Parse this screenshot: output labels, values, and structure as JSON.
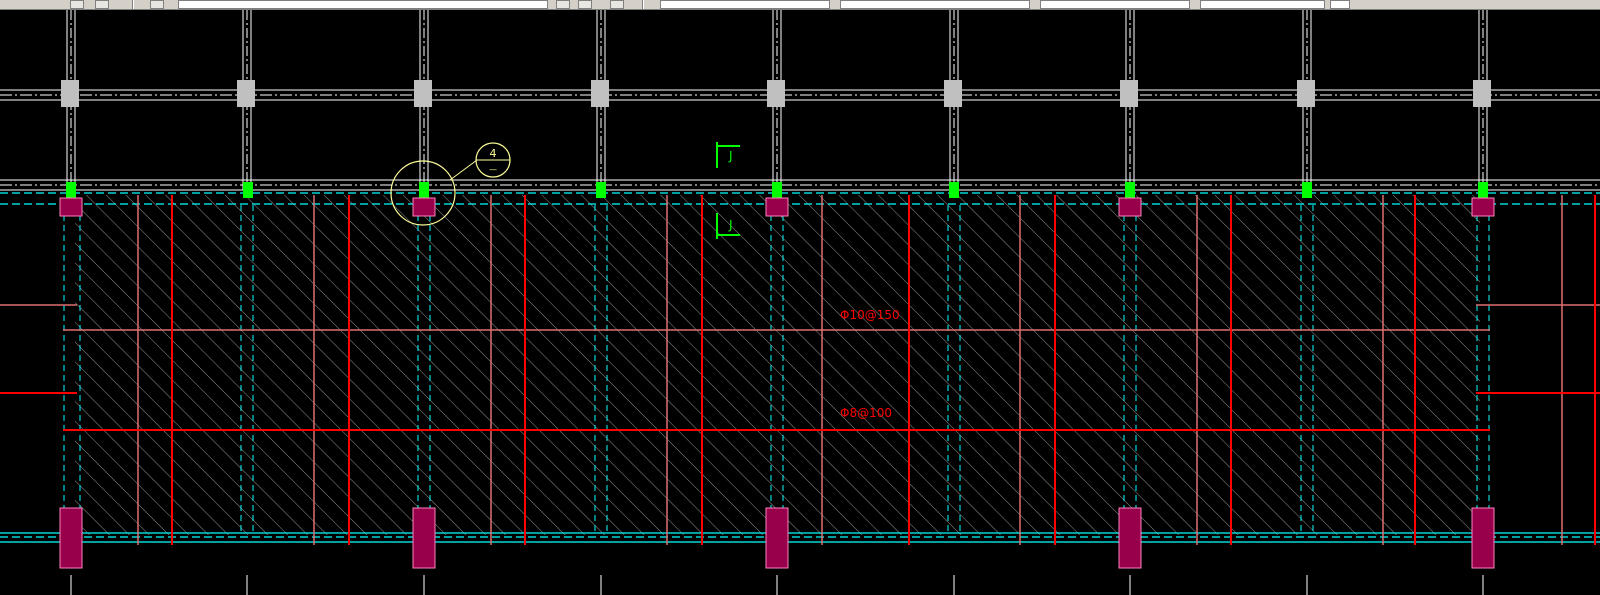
{
  "toolbar": {
    "combos": [
      "",
      "",
      "",
      "",
      "",
      ""
    ]
  },
  "drawing": {
    "rebar_top_label": "Φ10@150",
    "rebar_bottom_label": "Φ8@100",
    "detail_callout": {
      "number": "4",
      "sheet": "—"
    },
    "section_mark": {
      "letter": "J"
    },
    "colors": {
      "background": "#000000",
      "axis_lines": "#ffffff",
      "column_top": "#c0c0c0",
      "column_accent": "#00ff00",
      "column_base": "#99004c",
      "beam_dashed": "#00ffff",
      "rebar_light": "#e07070",
      "rebar_main": "#ff0000",
      "hatch": "#ffffff",
      "callout": "#ffff99",
      "section": "#00ff00"
    }
  }
}
